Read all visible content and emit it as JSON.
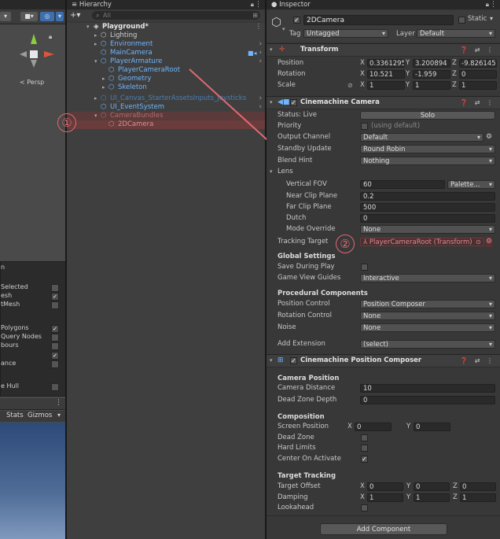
{
  "scene": {
    "persp_label": "< Persp",
    "overlay_items": [
      {
        "label": "n",
        "checked": null
      },
      {
        "label": "Selected",
        "checked": false
      },
      {
        "label": "esh",
        "checked": true
      },
      {
        "label": "tMesh",
        "checked": false
      },
      {
        "label": "Polygons",
        "checked": true
      },
      {
        "label": "Query Nodes",
        "checked": false
      },
      {
        "label": "bours",
        "checked": false
      },
      {
        "label": "",
        "checked": true
      },
      {
        "label": "ance",
        "checked": false
      },
      {
        "label": "e Hull",
        "checked": false
      }
    ],
    "game_toolbar": {
      "stats": "Stats",
      "gizmos": "Gizmos"
    }
  },
  "hierarchy": {
    "tab_title": "Hierarchy",
    "add_label": "+▾",
    "search_placeholder": "All",
    "items": [
      {
        "label": "Playground*",
        "indent": 0,
        "style": "scene"
      },
      {
        "label": "Lighting",
        "indent": 1,
        "style": "normal"
      },
      {
        "label": "Environment",
        "indent": 1,
        "style": "blue"
      },
      {
        "label": "MainCamera",
        "indent": 1,
        "style": "blue"
      },
      {
        "label": "PlayerArmature",
        "indent": 1,
        "style": "blue"
      },
      {
        "label": "PlayerCameraRoot",
        "indent": 2,
        "style": "blue"
      },
      {
        "label": "Geometry",
        "indent": 2,
        "style": "blue"
      },
      {
        "label": "Skeleton",
        "indent": 2,
        "style": "blue"
      },
      {
        "label": "UI_Canvas_StarterAssetsInputs_Joysticks",
        "indent": 1,
        "style": "blue-dim"
      },
      {
        "label": "UI_EventSystem",
        "indent": 1,
        "style": "blue"
      },
      {
        "label": "CameraBundles",
        "indent": 1,
        "style": "red-dim"
      },
      {
        "label": "2DCamera",
        "indent": 2,
        "style": "red-dim"
      }
    ]
  },
  "annotations": {
    "one": "①",
    "two": "②"
  },
  "inspector": {
    "tab_title": "Inspector",
    "object_name": "2DCamera",
    "static_label": "Static",
    "tag_label": "Tag",
    "tag_value": "Untagged",
    "layer_label": "Layer",
    "layer_value": "Default",
    "transform": {
      "title": "Transform",
      "position": {
        "label": "Position",
        "x": "0.3361295",
        "y": "3.200894",
        "z": "-9.826145"
      },
      "rotation": {
        "label": "Rotation",
        "x": "10.521",
        "y": "-1.959",
        "z": "0"
      },
      "scale": {
        "label": "Scale",
        "x": "1",
        "y": "1",
        "z": "1"
      }
    },
    "cine_camera": {
      "title": "Cinemachine Camera",
      "status": "Status: Live",
      "solo": "Solo",
      "priority_label": "Priority",
      "priority_value": "(using default)",
      "output_channel_label": "Output Channel",
      "output_channel_value": "Default",
      "standby_label": "Standby Update",
      "standby_value": "Round Robin",
      "blend_label": "Blend Hint",
      "blend_value": "Nothing",
      "lens_label": "Lens",
      "vfov_label": "Vertical FOV",
      "vfov_value": "60",
      "palette_value": "Palette...",
      "near_label": "Near Clip Plane",
      "near_value": "0.2",
      "far_label": "Far Clip Plane",
      "far_value": "500",
      "dutch_label": "Dutch",
      "dutch_value": "0",
      "mode_label": "Mode Override",
      "mode_value": "None",
      "tracking_label": "Tracking Target",
      "tracking_value": "PlayerCameraRoot (Transform)",
      "global_header": "Global Settings",
      "save_play_label": "Save During Play",
      "gvg_label": "Game View Guides",
      "gvg_value": "Interactive",
      "proc_header": "Procedural Components",
      "pos_ctrl_label": "Position Control",
      "pos_ctrl_value": "Position Composer",
      "rot_ctrl_label": "Rotation Control",
      "rot_ctrl_value": "None",
      "noise_label": "Noise",
      "noise_value": "None",
      "add_ext_label": "Add Extension",
      "add_ext_value": "(select)"
    },
    "composer": {
      "title": "Cinemachine Position Composer",
      "cam_pos_header": "Camera Position",
      "cam_dist_label": "Camera Distance",
      "cam_dist_value": "10",
      "dead_depth_label": "Dead Zone Depth",
      "dead_depth_value": "0",
      "comp_header": "Composition",
      "screen_pos_label": "Screen Position",
      "screen_x": "0",
      "screen_y": "0",
      "dead_zone_label": "Dead Zone",
      "hard_limits_label": "Hard Limits",
      "center_label": "Center On Activate",
      "tt_header": "Target Tracking",
      "offset_label": "Target Offset",
      "offset": {
        "x": "0",
        "y": "0",
        "z": "0"
      },
      "damping_label": "Damping",
      "damping": {
        "x": "1",
        "y": "1",
        "z": "1"
      },
      "lookahead_label": "Lookahead"
    },
    "add_component": "Add Component"
  }
}
